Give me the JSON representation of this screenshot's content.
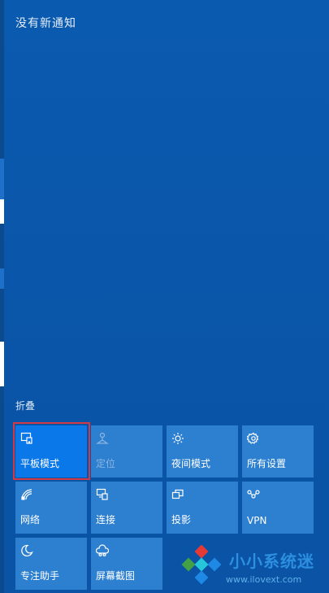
{
  "notifications": {
    "empty_text": "没有新通知"
  },
  "action_center": {
    "collapse_label": "折叠",
    "tiles": [
      {
        "id": "tablet-mode",
        "label": "平板模式",
        "icon": "tablet-mode-icon",
        "state": "on"
      },
      {
        "id": "location",
        "label": "定位",
        "icon": "location-icon",
        "state": "disabled"
      },
      {
        "id": "night-light",
        "label": "夜间模式",
        "icon": "night-light-icon",
        "state": "off"
      },
      {
        "id": "all-settings",
        "label": "所有设置",
        "icon": "settings-gear-icon",
        "state": "off"
      },
      {
        "id": "network",
        "label": "网络",
        "icon": "network-icon",
        "state": "off"
      },
      {
        "id": "connect",
        "label": "连接",
        "icon": "connect-icon",
        "state": "off"
      },
      {
        "id": "project",
        "label": "投影",
        "icon": "project-icon",
        "state": "off"
      },
      {
        "id": "vpn",
        "label": "VPN",
        "icon": "vpn-icon",
        "state": "off"
      },
      {
        "id": "focus-assist",
        "label": "专注助手",
        "icon": "moon-icon",
        "state": "off"
      },
      {
        "id": "screen-snip",
        "label": "屏幕截图",
        "icon": "screen-snip-icon",
        "state": "off"
      }
    ]
  },
  "watermark": {
    "name": "小小系统迷",
    "url": "www.ilovext.com"
  },
  "colors": {
    "panel": "#0a55a8",
    "tile": "#2d7fd0",
    "tile_active": "#0a78e8",
    "highlight": "#d23b46"
  }
}
